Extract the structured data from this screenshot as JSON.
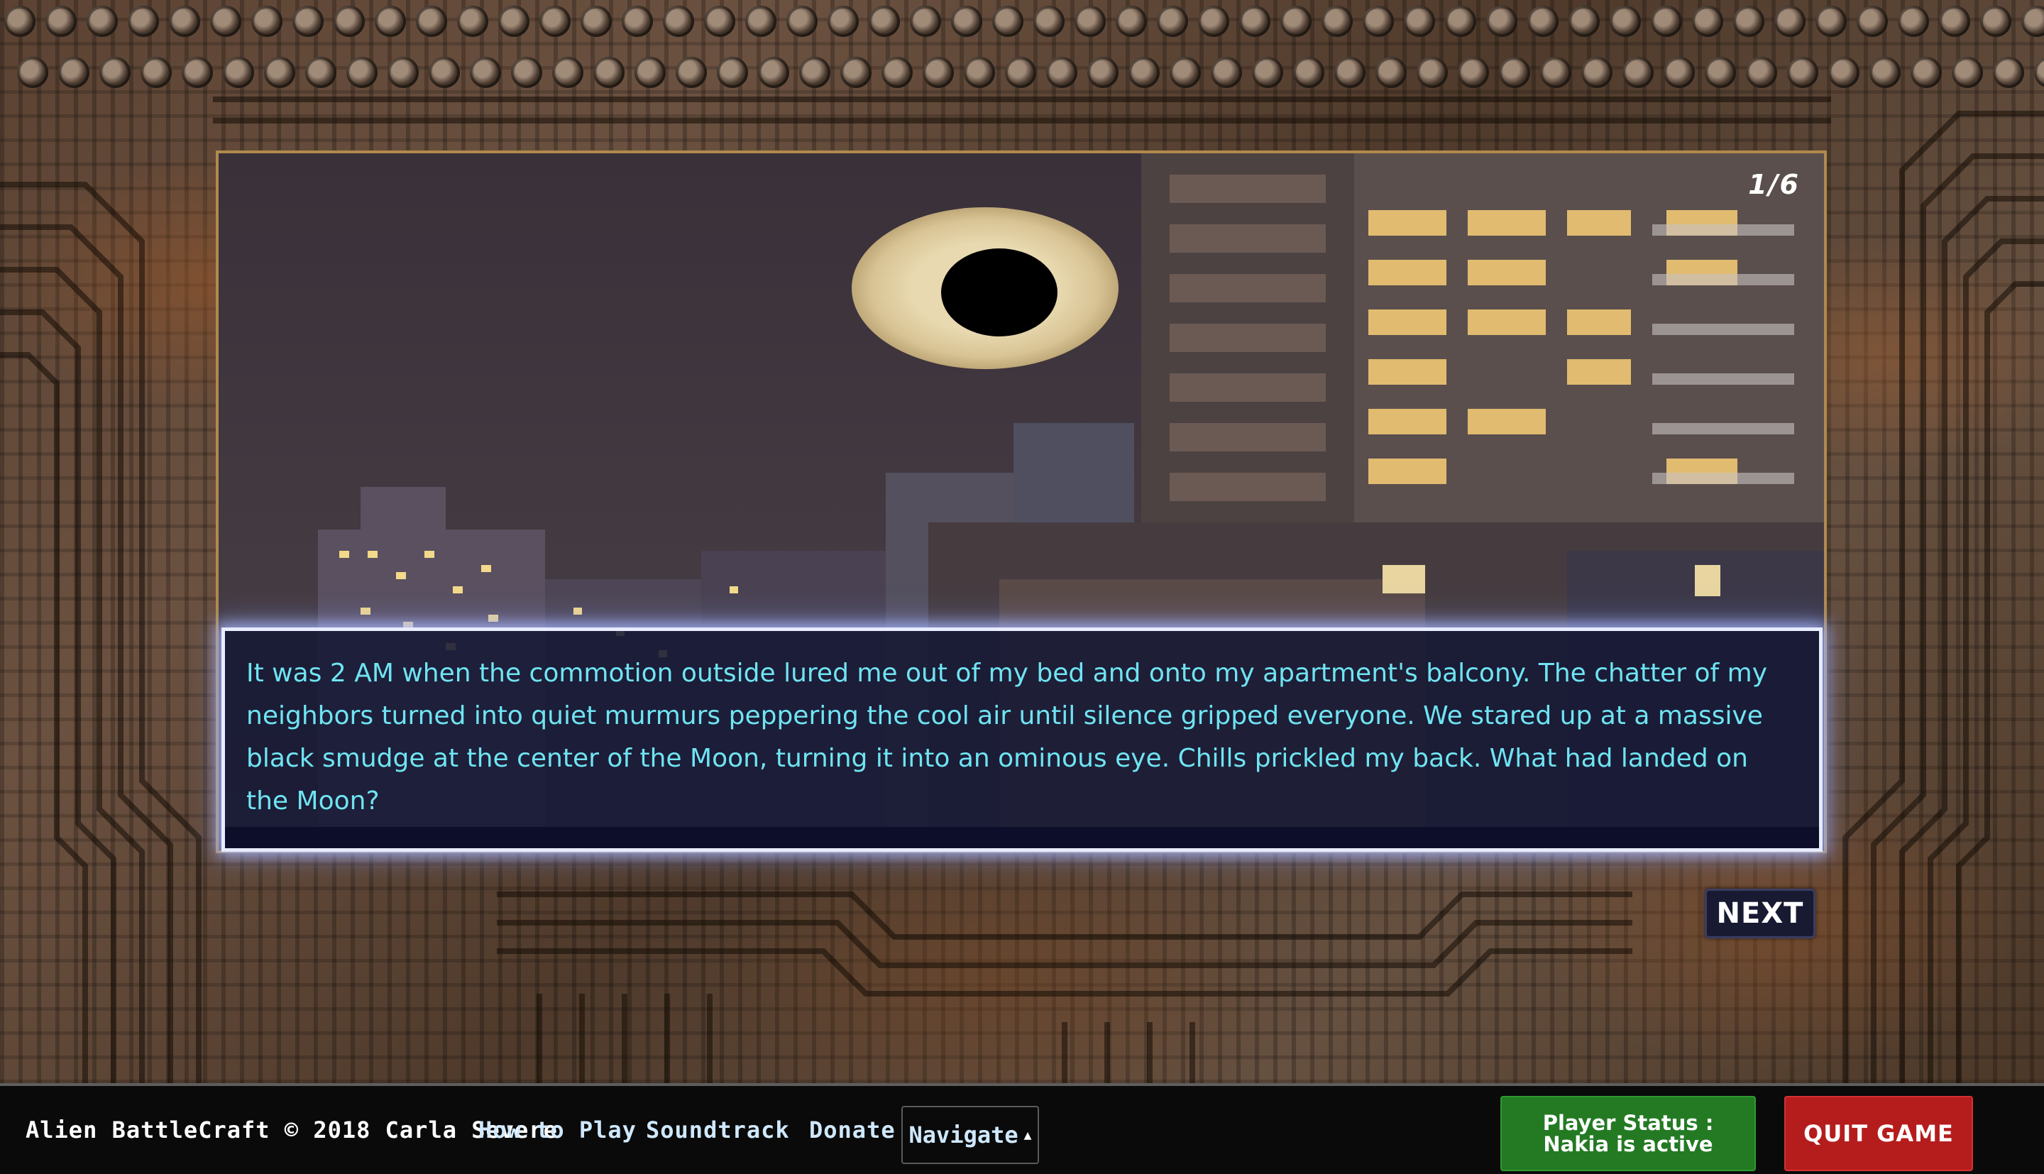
{
  "story": {
    "page_counter": "1/6",
    "narration": "It was 2 AM when the commotion outside lured me out of my bed and onto my apartment's balcony. The chatter of my neighbors turned into quiet murmurs peppering the cool air until silence gripped everyone. We stared up at a massive black smudge at the center of the Moon, turning it into an ominous eye. Chills prickled my back. What had landed on the Moon?",
    "next_label": "NEXT"
  },
  "footer": {
    "brand": "Alien BattleCraft © 2018 Carla Severe",
    "how_to_play": "How to Play",
    "soundtrack": "Soundtrack",
    "donate": "Donate",
    "navigate": "Navigate",
    "player_status_line1": "Player Status :",
    "player_status_line2": "Nakia is active",
    "quit": "QUIT GAME"
  },
  "colors": {
    "narration_text": "#6fe4f2",
    "narration_bg": "#161834",
    "player_status_bg": "#237a23",
    "quit_bg": "#b51d1d",
    "frame_border": "#b08a4e"
  },
  "icons": {
    "navigate_caret": "caret-up-icon"
  }
}
